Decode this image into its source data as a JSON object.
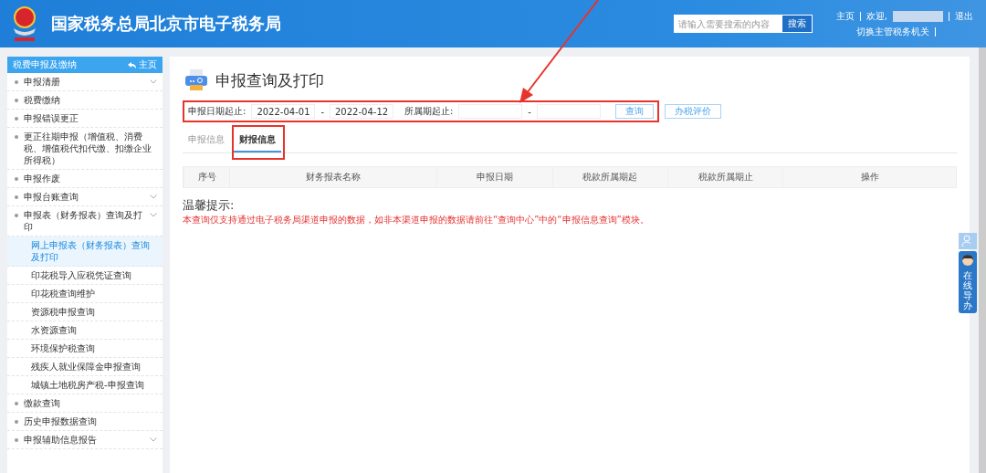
{
  "header": {
    "title": "国家税务总局北京市电子税务局",
    "search": {
      "placeholder": "请输入需要搜索的内容",
      "button": "搜索"
    },
    "links": [
      {
        "label": "主页"
      },
      {
        "label": "欢迎,"
      },
      {
        "label": "退出"
      }
    ],
    "switch_link": "切换主管税务机关"
  },
  "sidebar": {
    "title": "税费申报及缴纳",
    "home": "主页",
    "items": [
      {
        "label": "申报清册",
        "expandable": true,
        "selected": false
      },
      {
        "label": "税费缴纳",
        "expandable": false,
        "selected": false
      },
      {
        "label": "申报错误更正",
        "expandable": false,
        "selected": false
      },
      {
        "label": "更正往期申报（增值税、消费税、增值税代扣代缴、扣缴企业所得税）",
        "expandable": false,
        "selected": false
      },
      {
        "label": "申报作废",
        "expandable": false,
        "selected": false
      },
      {
        "label": "申报台账查询",
        "expandable": true,
        "selected": false
      },
      {
        "label": "申报表（财务报表）查询及打印",
        "expandable": true,
        "selected": false,
        "children": [
          {
            "label": "网上申报表（财务报表）查询及打印",
            "selected": true
          },
          {
            "label": "印花税导入应税凭证查询",
            "selected": false
          },
          {
            "label": "印花税查询维护",
            "selected": false
          },
          {
            "label": "资源税申报查询",
            "selected": false
          },
          {
            "label": "水资源查询",
            "selected": false
          },
          {
            "label": "环境保护税查询",
            "selected": false
          },
          {
            "label": "残疾人就业保障金申报查询",
            "selected": false
          },
          {
            "label": "城镇土地税房产税-申报查询",
            "selected": false
          }
        ]
      },
      {
        "label": "缴款查询",
        "expandable": false,
        "selected": false
      },
      {
        "label": "历史申报数据查询",
        "expandable": false,
        "selected": false
      },
      {
        "label": "申报辅助信息报告",
        "expandable": true,
        "selected": false
      }
    ]
  },
  "page": {
    "title": "申报查询及打印",
    "filter": {
      "date_label": "申报日期起止:",
      "date_from": "2022-04-01",
      "date_sep": "-",
      "date_to": "2022-04-12",
      "period_label": "所属期起止:",
      "period_sep": "-",
      "query_button": "查询",
      "rate_button": "办税评价"
    },
    "tabs": [
      {
        "label": "申报信息",
        "selected": false
      },
      {
        "label": "财报信息",
        "selected": true
      }
    ],
    "table": {
      "columns": [
        "序号",
        "财务报表名称",
        "申报日期",
        "税款所属期起",
        "税款所属期止",
        "操作"
      ]
    },
    "notice": {
      "title": "温馨提示:",
      "text": "本查询仅支持通过电子税务局渠道申报的数据，如非本渠道申报的数据请前往“查询中心”中的“申报信息查询”模块。"
    }
  },
  "side_widget": {
    "label": "在线导办"
  }
}
